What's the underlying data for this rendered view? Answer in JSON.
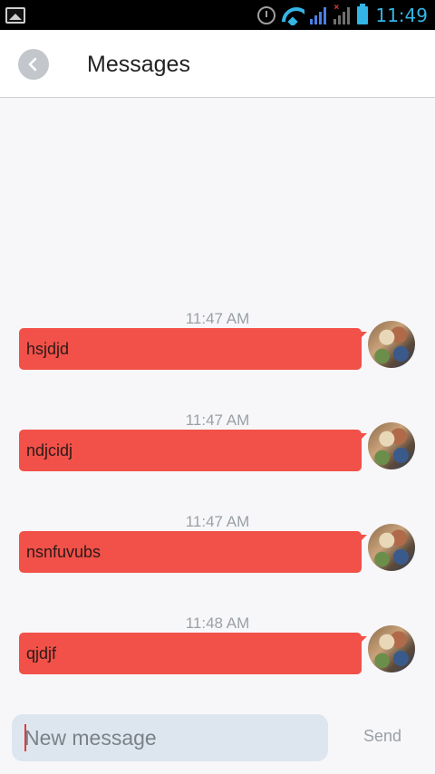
{
  "status_bar": {
    "time": "11:49",
    "icons": [
      "gallery-icon",
      "alarm-icon",
      "wifi-icon",
      "signal-icon",
      "signal-no-sim-icon",
      "battery-icon"
    ]
  },
  "header": {
    "title": "Messages",
    "back_icon": "chevron-left-icon"
  },
  "messages": [
    {
      "time": "11:47 AM",
      "text": "hsjdjd"
    },
    {
      "time": "11:47 AM",
      "text": "ndjcidj"
    },
    {
      "time": "11:47 AM",
      "text": "nsnfuvubs"
    },
    {
      "time": "11:48 AM",
      "text": "qjdjf"
    }
  ],
  "composer": {
    "placeholder": "New message",
    "value": "",
    "send_label": "Send"
  },
  "colors": {
    "bubble": "#f15148",
    "accent": "#33b5e5",
    "input_bg": "#dde6ef"
  }
}
